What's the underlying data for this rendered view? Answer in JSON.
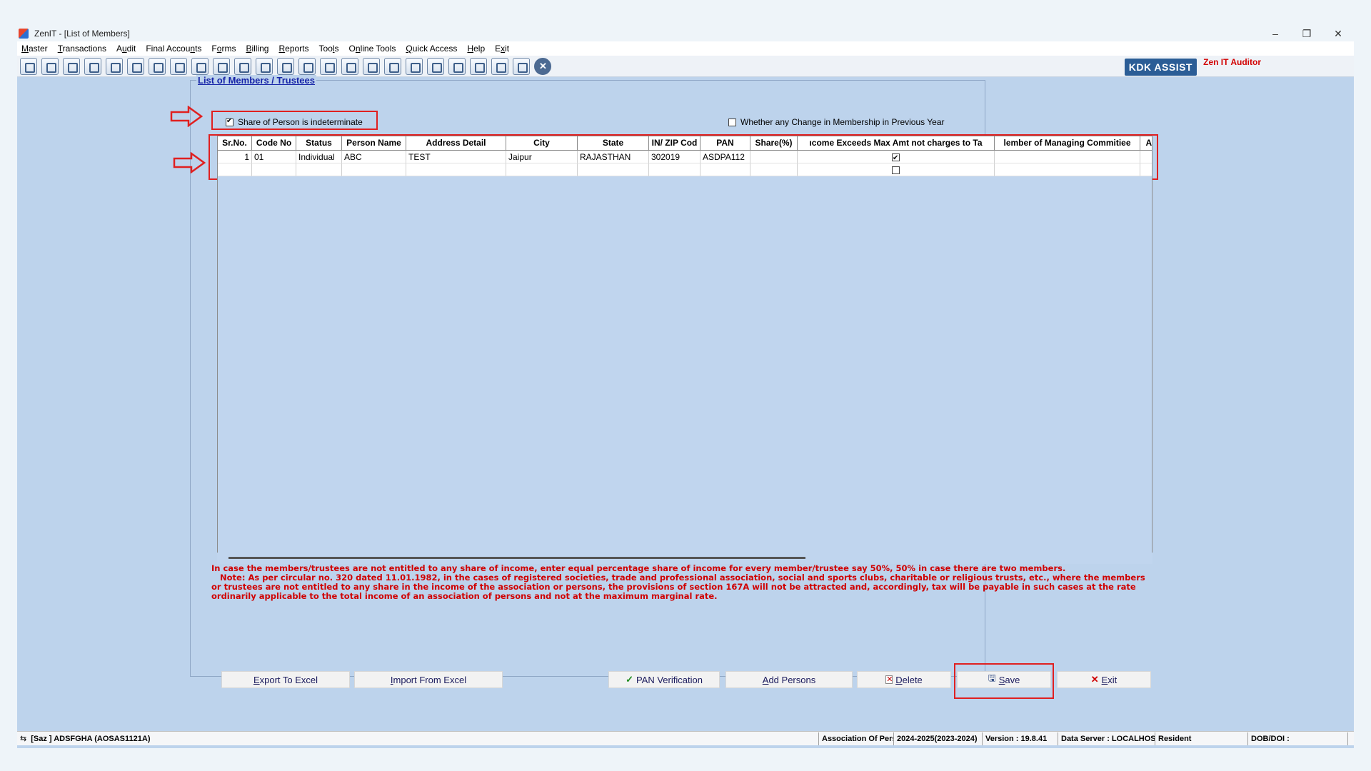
{
  "window": {
    "title": "ZenIT - [List of Members]",
    "controls": {
      "minimize": "–",
      "restore": "❐",
      "close": "✕"
    }
  },
  "menu": [
    {
      "key": "M",
      "rest": "aster"
    },
    {
      "key": "T",
      "rest": "ransactions"
    },
    {
      "pre": "A",
      "key": "u",
      "rest": "dit"
    },
    {
      "pre": "Final Accou",
      "key": "n",
      "rest": "ts"
    },
    {
      "pre": "F",
      "key": "o",
      "rest": "rms"
    },
    {
      "key": "B",
      "rest": "illing"
    },
    {
      "key": "R",
      "rest": "eports"
    },
    {
      "pre": "Too",
      "key": "l",
      "rest": "s"
    },
    {
      "pre": "O",
      "key": "n",
      "rest": "line Tools"
    },
    {
      "key": "Q",
      "rest": "uick Access"
    },
    {
      "key": "H",
      "rest": "elp"
    },
    {
      "pre": "E",
      "key": "x",
      "rest": "it"
    }
  ],
  "toolbar": {
    "kdk_label": "KDK ASSIST",
    "auditor_label": "Zen IT Auditor",
    "icons": [
      "calendar-icon",
      "home-icon",
      "building-icon",
      "bar-chart-icon",
      "calendar-grid-icon",
      "users-icon",
      "tools-icon",
      "filter-icon",
      "tax-icon",
      "disc-icon",
      "calculator-icon",
      "pie-chart-icon",
      "pas-icon",
      "book-icon",
      "info-icon",
      "report-icon",
      "document-icon",
      "date-icon",
      "mail-icon",
      "refresh-icon",
      "bs-icon",
      "printer-icon",
      "cd-icon",
      "register-icon",
      "close-circle-icon"
    ]
  },
  "panel": {
    "title": "List of Members / Trustees",
    "share_indeterminate_label": "Share of Person is indeterminate",
    "share_indeterminate_checked": true,
    "change_membership_label": "Whether any Change in Membership in Previous Year",
    "change_membership_checked": false
  },
  "grid": {
    "columns": [
      "Sr.No.",
      "Code No",
      "Status",
      "Person Name",
      "Address Detail",
      "City",
      "State",
      "IN/ ZIP Cod",
      "PAN",
      "Share(%)",
      "ıcome Exceeds Max Amt not charges to Ta",
      "lember of Managing Commitiee",
      "Admit"
    ],
    "rows": [
      {
        "sr": "1",
        "code": "01",
        "status": "Individual",
        "name": "ABC",
        "address": "TEST",
        "city": "Jaipur",
        "state": "RAJASTHAN",
        "zip": "302019",
        "pan": "ASDPA112",
        "share": "",
        "income_exceeds": true,
        "managing": "",
        "admit": ""
      },
      {
        "sr": "",
        "code": "",
        "status": "",
        "name": "",
        "address": "",
        "city": "",
        "state": "",
        "zip": "",
        "pan": "",
        "share": "",
        "income_exceeds": false,
        "managing": "",
        "admit": ""
      }
    ]
  },
  "note": {
    "line1": "In case the members/trustees are not entitled to any share of income, enter equal percentage share of income for every member/trustee say 50%, 50% in case there are two members.",
    "line2": "   Note: As per circular no. 320 dated 11.01.1982, in the cases of registered societies, trade and professional association, social and sports clubs, charitable or religious trusts, etc., where the members or trustees are not entitled to any share in the income of the association or persons, the provisions of section 167A will not be attracted and, accordingly, tax will be payable in such cases at the rate ordinarily applicable to the total income of an association of persons and not at the maximum marginal rate."
  },
  "buttons": {
    "export_key": "E",
    "export_rest": "xport To Excel",
    "import_key": "I",
    "import_rest": "mport From Excel",
    "pan_verification": "PAN Verification",
    "add_key": "A",
    "add_rest": "dd Persons",
    "delete_key": "D",
    "delete_rest": "elete",
    "save_key": "S",
    "save_rest": "ave",
    "exit_key": "E",
    "exit_rest": "xit"
  },
  "statusbar": {
    "user": "[Saz ] ADSFGHA (AOSAS1121A)",
    "status": "Association Of Persi",
    "year": "2024-2025(2023-2024)",
    "version": "Version : 19.8.41",
    "server": "Data Server : LOCALHOST",
    "residence": "Resident",
    "dob": "DOB/DOI :"
  },
  "colors": {
    "accent_red": "#e02020",
    "panel_bg": "#bdd3ec",
    "title_blue": "#1624a8",
    "note_red": "#d00000"
  }
}
